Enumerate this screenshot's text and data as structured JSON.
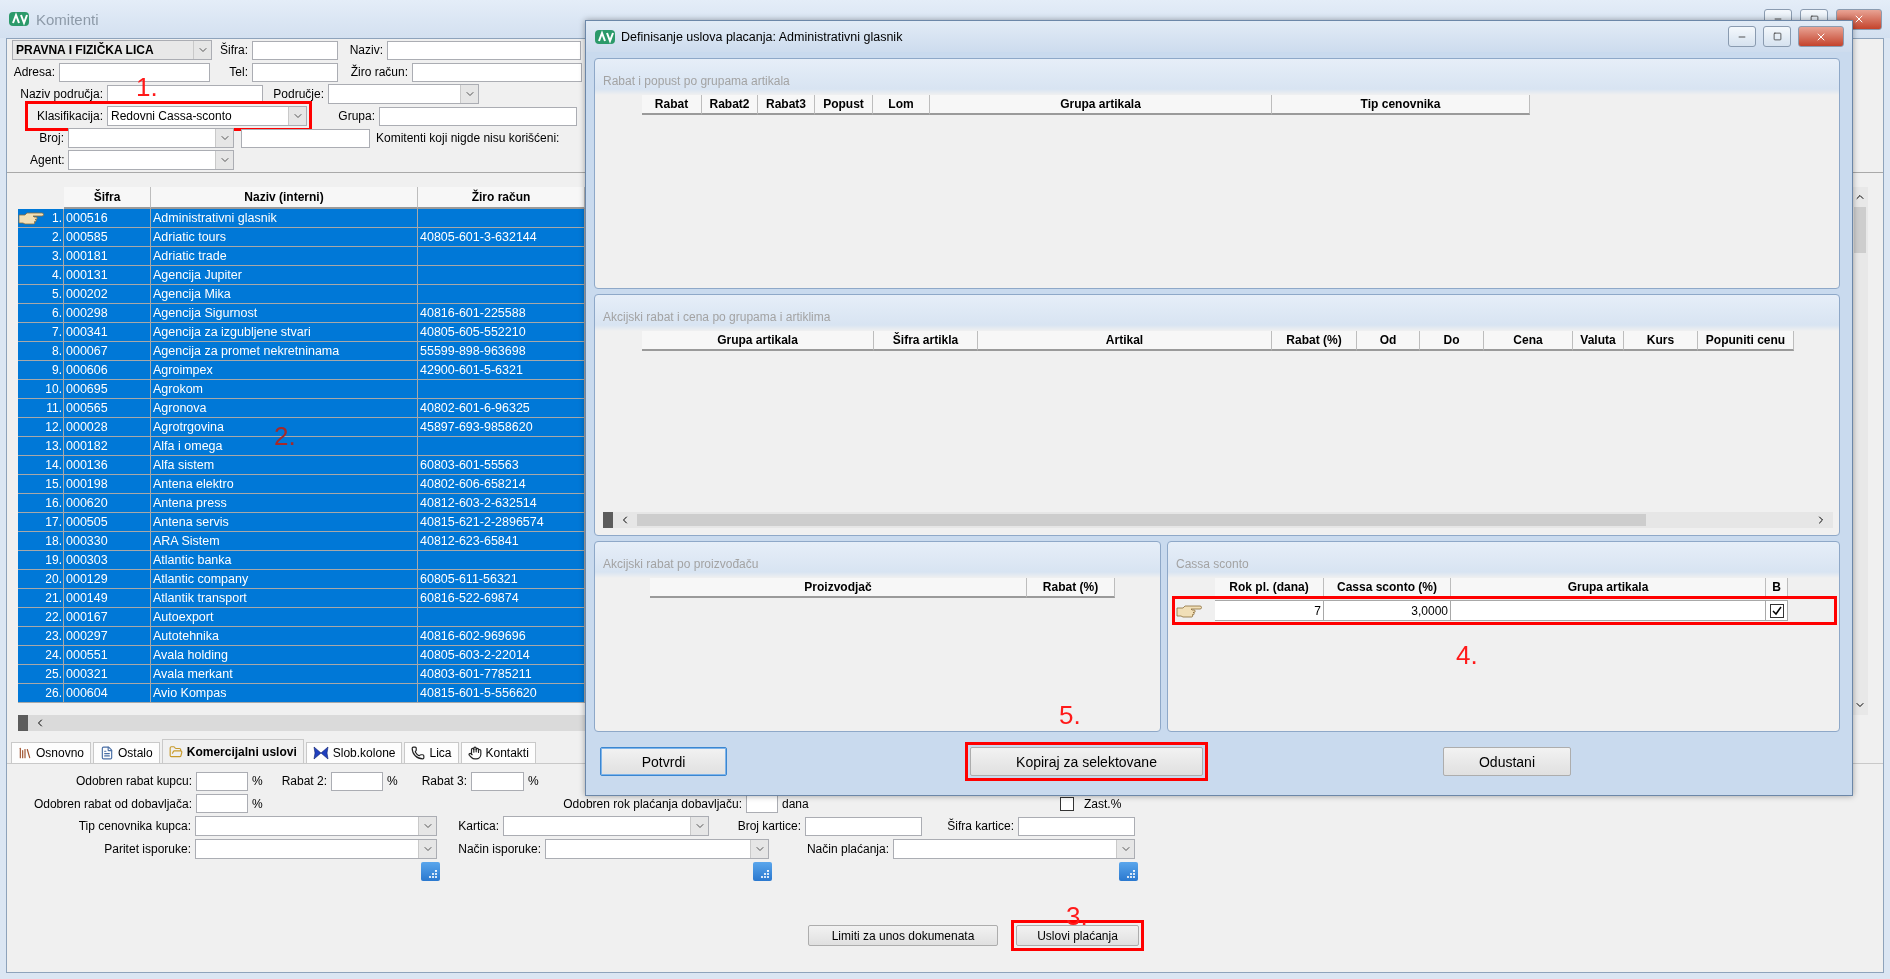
{
  "main_window": {
    "title": "Komitenti"
  },
  "filters": [
    [
      {
        "kind": "select",
        "value": "PRAVNA I FIZIČKA LICA",
        "highlighted": false
      },
      {
        "kind": "field",
        "label": "Šifra:",
        "highlighted": false
      },
      {
        "kind": "field",
        "label": "Naziv:",
        "highlighted": false
      }
    ],
    [
      {
        "kind": "field",
        "label": "Adresa:",
        "highlighted": false
      },
      {
        "kind": "field",
        "label": "Tel:",
        "highlighted": false
      },
      {
        "kind": "field",
        "label": "Žiro račun:",
        "highlighted": false
      }
    ],
    [
      {
        "kind": "field",
        "label": "Naziv područja:",
        "highlighted": false
      },
      {
        "kind": "select",
        "label": "Područje:",
        "highlighted": false
      }
    ],
    [
      {
        "kind": "select",
        "label": "Klasifikacija:",
        "value": "Redovni Cassa-sconto",
        "highlighted": true
      },
      {
        "kind": "field",
        "label": "Grupa:",
        "highlighted": false
      }
    ],
    [
      {
        "kind": "select",
        "label": "Broj:",
        "highlighted": false
      },
      {
        "kind": "field",
        "highlighted": false
      },
      {
        "kind": "label",
        "label": "Komitenti koji nigde nisu korišćeni:",
        "highlighted": false
      }
    ],
    [
      {
        "kind": "select",
        "label": "Agent:",
        "highlighted": false
      }
    ]
  ],
  "grid": {
    "columns": [
      "Šifra",
      "Naziv (interni)",
      "Žiro račun"
    ],
    "rows": [
      {
        "number": "1.",
        "code": "000516",
        "name": "Administrativni glasnik",
        "current": true,
        "selected": true
      },
      {
        "number": "2.",
        "code": "000585",
        "name": "Adriatic tours",
        "account": "40805-601-3-632144",
        "current": false,
        "selected": true
      },
      {
        "number": "3.",
        "code": "000181",
        "name": "Adriatic trade",
        "current": false,
        "selected": true
      },
      {
        "number": "4.",
        "code": "000131",
        "name": "Agencija Jupiter",
        "current": false,
        "selected": true
      },
      {
        "number": "5.",
        "code": "000202",
        "name": "Agencija Mika",
        "current": false,
        "selected": true
      },
      {
        "number": "6.",
        "code": "000298",
        "name": "Agencija Sigurnost",
        "account": "40816-601-225588",
        "current": false,
        "selected": true
      },
      {
        "number": "7.",
        "code": "000341",
        "name": "Agencija za izgubljene stvari",
        "account": "40805-605-552210",
        "current": false,
        "selected": true
      },
      {
        "number": "8.",
        "code": "000067",
        "name": "Agencija za promet nekretninama",
        "account": "55599-898-963698",
        "current": false,
        "selected": true
      },
      {
        "number": "9.",
        "code": "000606",
        "name": "Agroimpex",
        "account": "42900-601-5-6321",
        "current": false,
        "selected": true
      },
      {
        "number": "10.",
        "code": "000695",
        "name": "Agrokom",
        "current": false,
        "selected": true
      },
      {
        "number": "11.",
        "code": "000565",
        "name": "Agronova",
        "account": "40802-601-6-96325",
        "current": false,
        "selected": true
      },
      {
        "number": "12.",
        "code": "000028",
        "name": "Agrotrgovina",
        "account": "45897-693-9858620",
        "current": false,
        "selected": true
      },
      {
        "number": "13.",
        "code": "000182",
        "name": "Alfa i omega",
        "current": false,
        "selected": true
      },
      {
        "number": "14.",
        "code": "000136",
        "name": "Alfa sistem",
        "account": "60803-601-55563",
        "current": false,
        "selected": true
      },
      {
        "number": "15.",
        "code": "000198",
        "name": "Antena elektro",
        "account": "40802-606-658214",
        "current": false,
        "selected": true
      },
      {
        "number": "16.",
        "code": "000620",
        "name": "Antena press",
        "account": "40812-603-2-632514",
        "current": false,
        "selected": true
      },
      {
        "number": "17.",
        "code": "000505",
        "name": "Antena servis",
        "account": "40815-621-2-2896574",
        "current": false,
        "selected": true
      },
      {
        "number": "18.",
        "code": "000330",
        "name": "ARA Sistem",
        "account": "40812-623-65841",
        "current": false,
        "selected": true
      },
      {
        "number": "19.",
        "code": "000303",
        "name": "Atlantic banka",
        "current": false,
        "selected": true
      },
      {
        "number": "20.",
        "code": "000129",
        "name": "Atlantic company",
        "account": "60805-611-56321",
        "current": false,
        "selected": true
      },
      {
        "number": "21.",
        "code": "000149",
        "name": "Atlantik transport",
        "account": "60816-522-69874",
        "current": false,
        "selected": true
      },
      {
        "number": "22.",
        "code": "000167",
        "name": "Autoexport",
        "current": false,
        "selected": true
      },
      {
        "number": "23.",
        "code": "000297",
        "name": "Autotehnika",
        "account": "40816-602-969696",
        "current": false,
        "selected": true
      },
      {
        "number": "24.",
        "code": "000551",
        "name": "Avala holding",
        "account": "40805-603-2-22014",
        "current": false,
        "selected": true
      },
      {
        "number": "25.",
        "code": "000321",
        "name": "Avala merkant",
        "account": "40803-601-7785211",
        "current": false,
        "selected": true
      },
      {
        "number": "26.",
        "code": "000604",
        "name": "Avio Kompas",
        "account": "40815-601-5-556620",
        "current": false,
        "selected": true
      }
    ]
  },
  "tabs": [
    {
      "label": "Osnovno",
      "selected": false
    },
    {
      "label": "Ostalo",
      "selected": false
    },
    {
      "label": "Komercijalni uslovi",
      "selected": true
    },
    {
      "label": "Slob.kolone",
      "selected": false
    },
    {
      "label": "Lica",
      "selected": false
    },
    {
      "label": "Kontakti",
      "selected": false
    }
  ],
  "commercial_form": [
    [
      {
        "kind": "field",
        "label": "Odobren rabat kupcu:",
        "unit": "%"
      },
      {
        "kind": "field",
        "label": "Rabat 2:",
        "unit": "%"
      },
      {
        "kind": "field",
        "label": "Rabat 3:",
        "unit": "%"
      }
    ],
    [
      {
        "kind": "field",
        "label": "Odobren rabat od dobavljača:",
        "unit": "%"
      },
      {
        "kind": "field",
        "label": "Odobren rok plaćanja dobavljaču:",
        "unit": "dana"
      },
      {
        "kind": "checkbox",
        "label": "Zast.%",
        "checked": false
      }
    ],
    [
      {
        "kind": "select",
        "label": "Tip cenovnika kupca:"
      },
      {
        "kind": "select",
        "label": "Kartica:"
      },
      {
        "kind": "field",
        "label": "Broj kartice:"
      },
      {
        "kind": "field",
        "label": "Šifra kartice:"
      }
    ],
    [
      {
        "kind": "select",
        "label": "Paritet isporuke:"
      },
      {
        "kind": "select",
        "label": "Način isporuke:"
      },
      {
        "kind": "select",
        "label": "Način plaćanja:"
      }
    ]
  ],
  "commercial_buttons": [
    {
      "label": "Limiti za unos dokumenata",
      "highlighted": false
    },
    {
      "label": "Uslovi plaćanja",
      "highlighted": true
    }
  ],
  "dialog": {
    "title": "Definisanje uslova placanja: Administrativni glasnik",
    "panels": [
      {
        "title": "Rabat i popust po grupama artikala",
        "columns": [
          "Rabat",
          "Rabat2",
          "Rabat3",
          "Popust",
          "Lom",
          "Grupa artikala",
          "Tip cenovnika"
        ]
      },
      {
        "title": "Akcijski rabat i cena po grupama i artiklima",
        "columns": [
          "Grupa artikala",
          "Šifra artikla",
          "Artikal",
          "Rabat (%)",
          "Od",
          "Do",
          "Cena",
          "Valuta",
          "Kurs",
          "Popuniti cenu"
        ]
      },
      {
        "title": "Akcijski rabat po proizvođaču",
        "columns": [
          "Proizvodjač",
          "Rabat (%)"
        ]
      },
      {
        "title": "Cassa sconto",
        "columns": [
          "Rok pl. (dana)",
          "Cassa sconto (%)",
          "Grupa artikala",
          "B"
        ],
        "rows": [
          {
            "days": "7",
            "percent": "3,0000",
            "checked": true,
            "current": true,
            "highlighted": true
          }
        ]
      }
    ],
    "buttons": [
      {
        "label": "Potvrdi",
        "focused": true,
        "highlighted": false
      },
      {
        "label": "Kopiraj za selektovane",
        "focused": false,
        "highlighted": true
      },
      {
        "label": "Odustani",
        "focused": false,
        "highlighted": false
      }
    ]
  },
  "annotations": [
    "1.",
    "2.",
    "3.",
    "4.",
    "5."
  ]
}
